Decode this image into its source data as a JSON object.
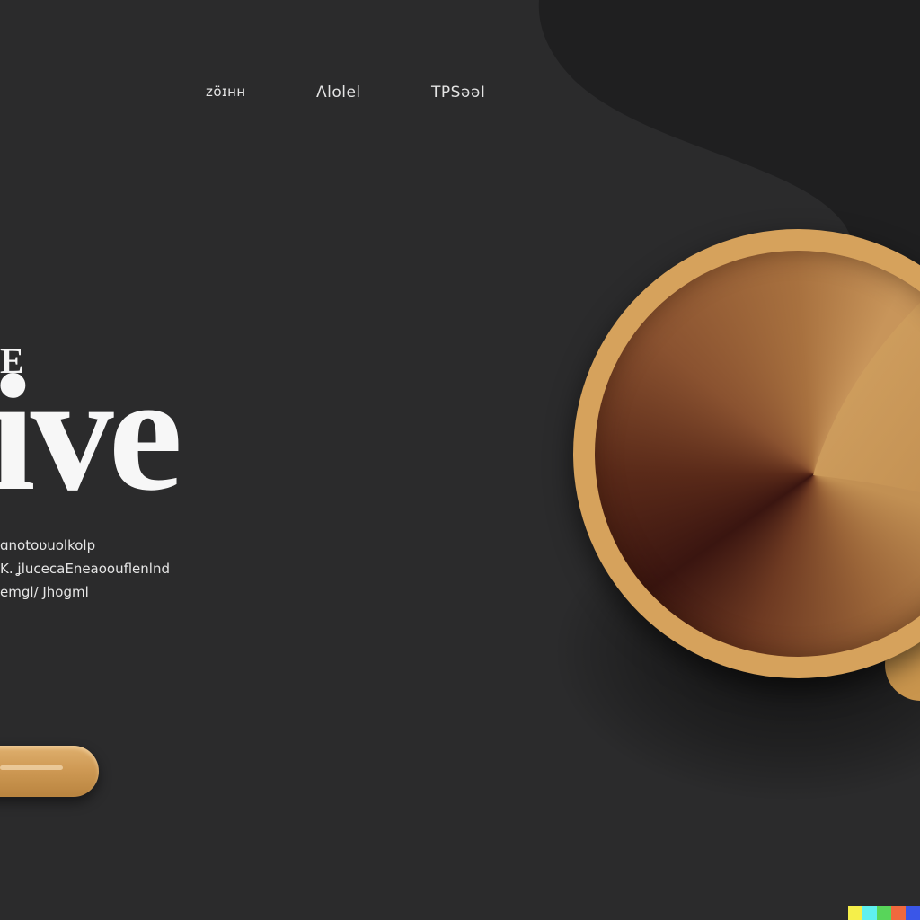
{
  "nav": {
    "items": [
      {
        "label": "ᴢöɪнн"
      },
      {
        "label": "Ʌlolel"
      },
      {
        "label": "TPSǝǝI"
      }
    ]
  },
  "hero": {
    "kicker": "E",
    "title": "ive",
    "description_lines": [
      "ɑnotoʋuolkolp",
      "K. ʝlucecaEneaoouflenlnd",
      "emgl/ Jhogml"
    ]
  },
  "colors": {
    "background": "#2b2b2c",
    "accent": "#d6a25c",
    "swatches": [
      "#f5ef4a",
      "#5ff0ef",
      "#58d55a",
      "#f0693e",
      "#3a56e8"
    ]
  },
  "icons": {
    "cta": "pill-button",
    "illustration": "coffee-cup-icon"
  }
}
